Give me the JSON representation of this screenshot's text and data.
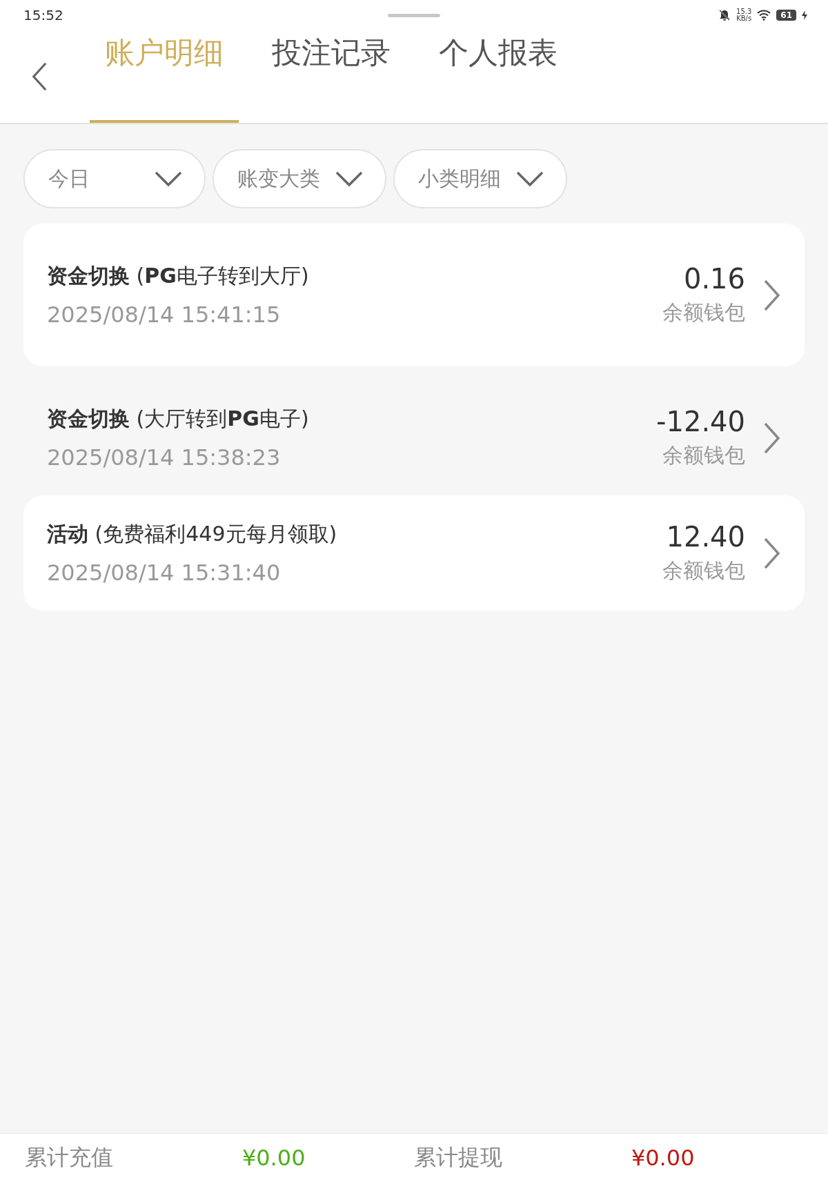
{
  "status_bar": {
    "time": "15:52",
    "speed": "15.3",
    "speed_unit": "KB/s",
    "battery": "61"
  },
  "tabs": [
    {
      "label": "账户明细",
      "selected": true
    },
    {
      "label": "投注记录",
      "selected": false
    },
    {
      "label": "个人报表",
      "selected": false
    }
  ],
  "filters": [
    {
      "label": "今日"
    },
    {
      "label": "账变大类"
    },
    {
      "label": "小类明细"
    }
  ],
  "records": [
    {
      "kind": "card",
      "title": "**资金切换** (**PG**电子转到大厅)",
      "time": "2025/08/14 15:41:15",
      "amount": "0.16",
      "wallet": "余额钱包"
    },
    {
      "kind": "plain",
      "title": "**资金切换** (大厅转到**PG**电子)",
      "time": "2025/08/14 15:38:23",
      "amount": "-12.40",
      "wallet": "余额钱包"
    },
    {
      "kind": "card",
      "title": "**活动** (免费福利449元每月领取)",
      "time": "2025/08/14 15:31:40",
      "amount": "12.40",
      "wallet": "余额钱包"
    }
  ],
  "totals": [
    {
      "label": "累计充值",
      "value": "¥0.00",
      "color": "#4caf1a"
    },
    {
      "label": "累计提现",
      "value": "¥0.00",
      "color": "#c0180f"
    }
  ]
}
